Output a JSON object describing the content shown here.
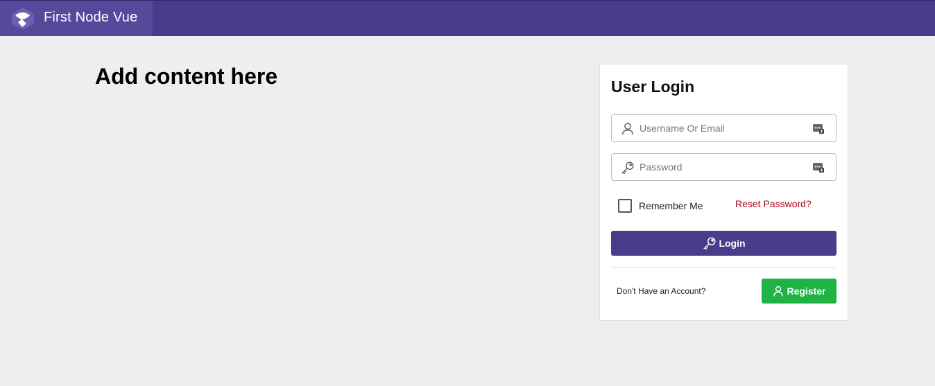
{
  "app": {
    "title": "First Node Vue",
    "logo_icon": "app-logo-icon"
  },
  "main": {
    "heading": "Add content here"
  },
  "login": {
    "title": "User Login",
    "username_placeholder": "Username Or Email",
    "password_placeholder": "Password",
    "remember_label": "Remember Me",
    "reset_link": "Reset Password?",
    "login_button": "Login",
    "no_account_text": "Don't Have an Account?",
    "register_button": "Register"
  },
  "colors": {
    "primary": "#483d8b",
    "success": "#1fb346",
    "link": "#b00020",
    "background": "#eeeeee"
  }
}
